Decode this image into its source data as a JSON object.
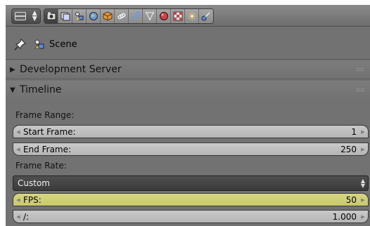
{
  "toolbar": {
    "editor_type_icon": "properties-editor-icon",
    "context_tabs": [
      {
        "icon": "render-icon",
        "active": true
      },
      {
        "icon": "render-layers-icon",
        "active": false
      },
      {
        "icon": "scene-icon",
        "active": false
      },
      {
        "icon": "world-icon",
        "active": false
      },
      {
        "icon": "object-icon",
        "active": false
      },
      {
        "icon": "constraints-icon",
        "active": false
      },
      {
        "icon": "modifiers-wrench-icon",
        "active": false
      },
      {
        "icon": "object-data-mesh-icon",
        "active": false
      },
      {
        "icon": "material-icon",
        "active": false
      },
      {
        "icon": "texture-icon",
        "active": false
      },
      {
        "icon": "particles-icon",
        "active": false
      },
      {
        "icon": "physics-icon",
        "active": false
      }
    ]
  },
  "breadcrumb": {
    "label": "Scene"
  },
  "panels": {
    "development_server": {
      "title": "Development Server",
      "expanded": false
    },
    "timeline": {
      "title": "Timeline",
      "expanded": true,
      "frame_range_label": "Frame Range:",
      "start_frame": {
        "label": "Start Frame:",
        "value": "1"
      },
      "end_frame": {
        "label": "End Frame:",
        "value": "250"
      },
      "frame_rate_label": "Frame Rate:",
      "frame_rate_preset": "Custom",
      "fps": {
        "label": "FPS:",
        "value": "50"
      },
      "fps_base": {
        "label": "/:",
        "value": "1.000"
      }
    }
  },
  "colors": {
    "panel_bg": "#727272",
    "field_bg": "#c0c0c0",
    "highlight_field": "#cccc72",
    "dropdown_bg": "#454545"
  }
}
